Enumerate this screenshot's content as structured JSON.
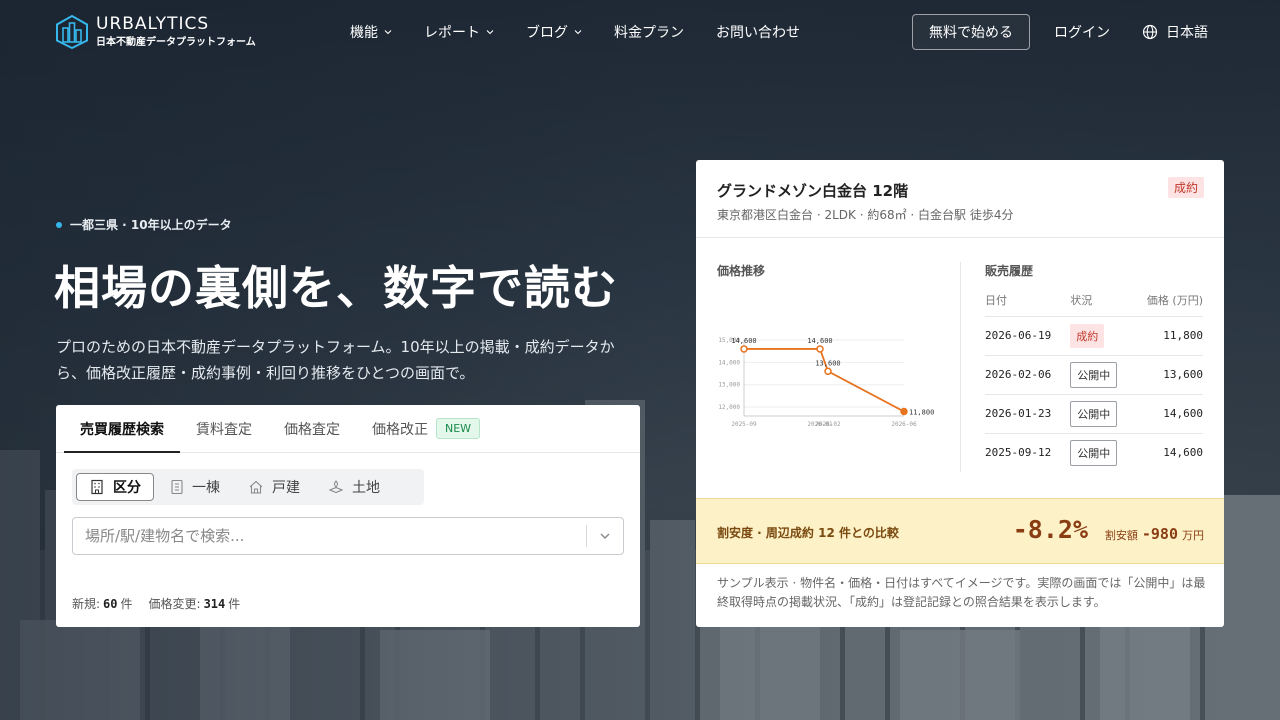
{
  "brand": {
    "name": "URBALYTICS",
    "subtitle": "日本不動産データプラットフォーム"
  },
  "nav": {
    "items": [
      {
        "label": "機能",
        "has_dropdown": true
      },
      {
        "label": "レポート",
        "has_dropdown": true
      },
      {
        "label": "ブログ",
        "has_dropdown": true
      },
      {
        "label": "料金プラン",
        "has_dropdown": false
      },
      {
        "label": "お問い合わせ",
        "has_dropdown": false
      }
    ],
    "cta_label": "無料で始める",
    "login_label": "ログイン",
    "language_label": "日本語"
  },
  "hero": {
    "tagline": "一都三県 · 10年以上のデータ",
    "title": "相場の裏側を、数字で読む",
    "description": "プロのための日本不動産データプラットフォーム。10年以上の掲載・成約データから、価格改正履歴・成約事例・利回り推移をひとつの画面で。"
  },
  "search": {
    "tabs": [
      {
        "label": "売買履歴検索",
        "active": true
      },
      {
        "label": "賃料査定",
        "active": false
      },
      {
        "label": "価格査定",
        "active": false
      },
      {
        "label": "価格改正",
        "active": false,
        "badge": "NEW"
      }
    ],
    "property_types": [
      {
        "label": "区分",
        "icon": "building-icon",
        "active": true
      },
      {
        "label": "一棟",
        "icon": "apartment-icon",
        "active": false
      },
      {
        "label": "戸建",
        "icon": "house-icon",
        "active": false
      },
      {
        "label": "土地",
        "icon": "land-icon",
        "active": false
      }
    ],
    "placeholder": "場所/駅/建物名で検索...",
    "stats": {
      "new_label": "新規:",
      "new_count": "60",
      "new_unit": "件",
      "change_label": "価格変更:",
      "change_count": "314",
      "change_unit": "件"
    }
  },
  "property": {
    "title": "グランドメゾン白金台 12階",
    "subtitle": "東京都港区白金台 · 2LDK · 約68㎡ · 白金台駅 徒歩4分",
    "status": "成約",
    "chart_title": "価格推移",
    "history_title": "販売履歴",
    "history_columns": [
      "日付",
      "状況",
      "価格 (万円)"
    ],
    "history": [
      {
        "date": "2026-06-19",
        "status": "成約",
        "kind": "sold",
        "price": "11,800"
      },
      {
        "date": "2026-02-06",
        "status": "公開中",
        "kind": "open",
        "price": "13,600"
      },
      {
        "date": "2026-01-23",
        "status": "公開中",
        "kind": "open",
        "price": "14,600"
      },
      {
        "date": "2025-09-12",
        "status": "公開中",
        "kind": "open",
        "price": "14,600"
      }
    ],
    "compare_label": "割安度 · 周辺成約 12 件との比較",
    "compare_pct": "-8.2%",
    "compare_diff_label": "割安額",
    "compare_diff_value": "-980",
    "compare_diff_unit": "万円",
    "note": "サンプル表示 · 物件名・価格・日付はすべてイメージです。実際の画面では「公開中」は最終取得時点の掲載状況、「成約」は登記記録との照合結果を表示します。"
  },
  "chart_data": {
    "type": "line",
    "x": [
      "2025-09",
      "2026-01",
      "2026-02",
      "2026-06"
    ],
    "x_dates": [
      "2025-09-12",
      "2026-01-23",
      "2026-02-06",
      "2026-06-19"
    ],
    "values": [
      14600,
      14600,
      13600,
      11800
    ],
    "point_labels": [
      "14,600",
      "14,600",
      "13,600",
      "11,800"
    ],
    "y_ticks": [
      "15,000",
      "14,000",
      "13,000",
      "12,000"
    ],
    "ylim": [
      11600,
      15000
    ],
    "grid": true,
    "color": "#e8731f"
  },
  "colors": {
    "accent_blue": "#36b6ea",
    "line_orange": "#e8731f",
    "sold_red": "#c0392b",
    "compare_bg": "#fdf1c7"
  }
}
